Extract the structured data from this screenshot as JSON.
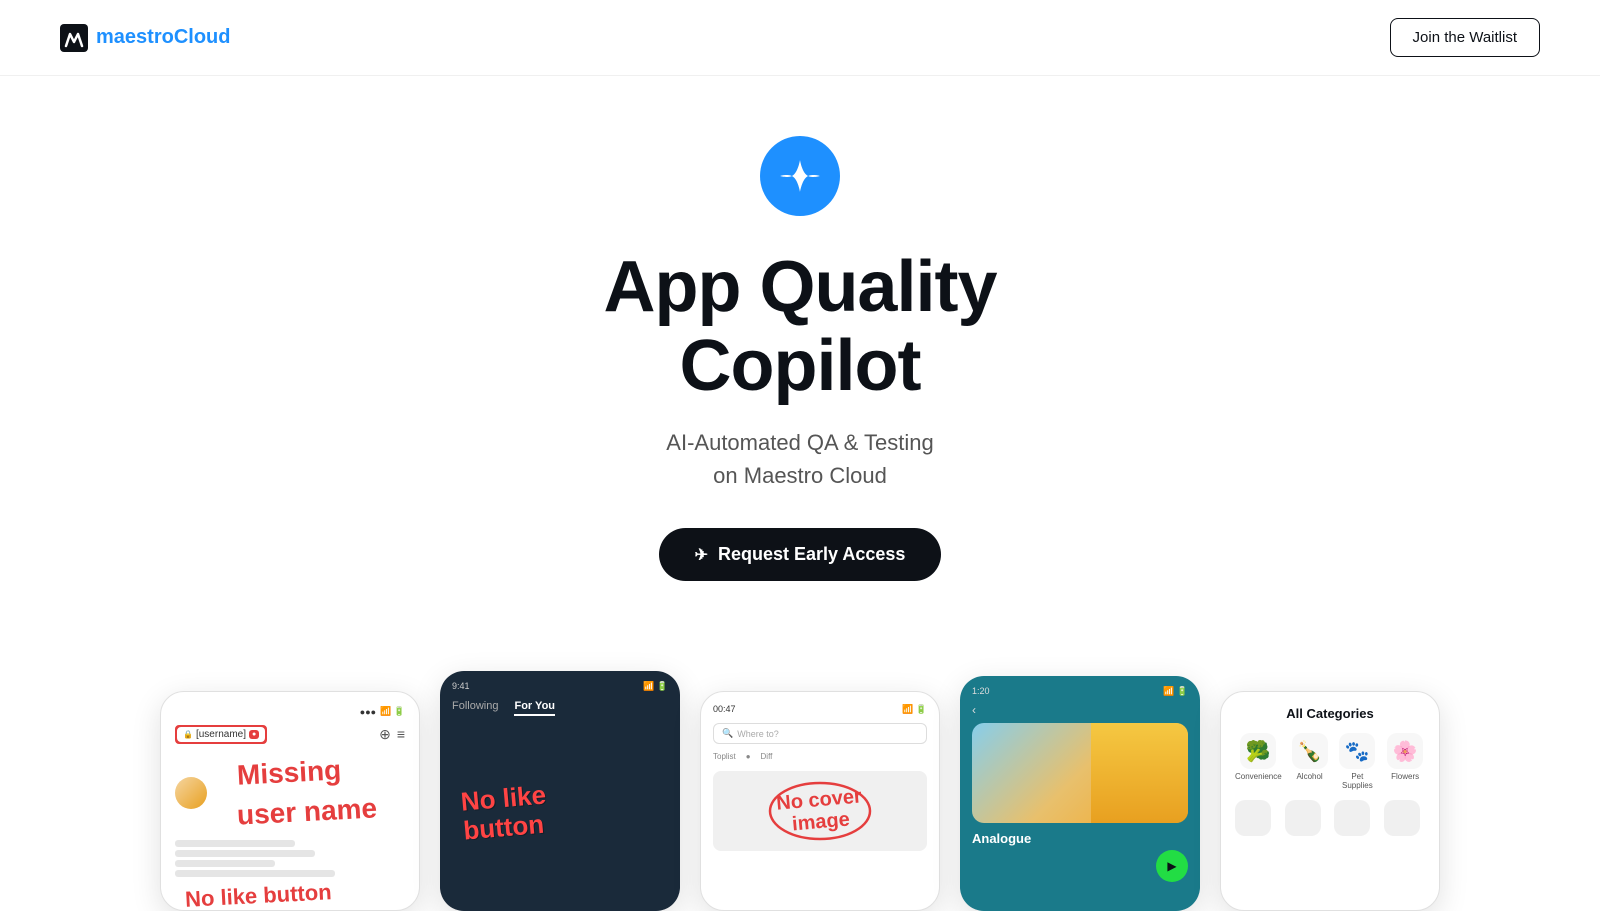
{
  "header": {
    "logo_text_regular": "maestro",
    "logo_text_colored": "Cloud",
    "waitlist_btn": "Join the Waitlist"
  },
  "hero": {
    "icon_alt": "maestro-star-icon",
    "title_line1": "App Quality",
    "title_line2": "Copilot",
    "subtitle_line1": "AI-Automated QA & Testing",
    "subtitle_line2": "on Maestro Cloud",
    "cta_label": "Request Early Access",
    "cta_icon": "✈"
  },
  "screenshots": {
    "card1": {
      "username_label": "[username]",
      "missing_line1": "Missing",
      "missing_line2": "user name",
      "no_like": "No like button"
    },
    "card2": {
      "tab1": "Following",
      "tab2": "For You",
      "no_like_btn": "No like button"
    },
    "card3": {
      "time": "00:47",
      "search_placeholder": "Where to?",
      "no_cover_line1": "No cover",
      "no_cover_line2": "image"
    },
    "card4": {
      "time": "1:20",
      "song_title": "Analogue"
    },
    "card5": {
      "title": "All Categories",
      "categories": [
        {
          "label": "Convenience",
          "emoji": "🥦"
        },
        {
          "label": "Alcohol",
          "emoji": "🍾"
        },
        {
          "label": "Pet Supplies",
          "emoji": "🐾"
        },
        {
          "label": "Flowers",
          "emoji": "🌸"
        }
      ]
    }
  }
}
